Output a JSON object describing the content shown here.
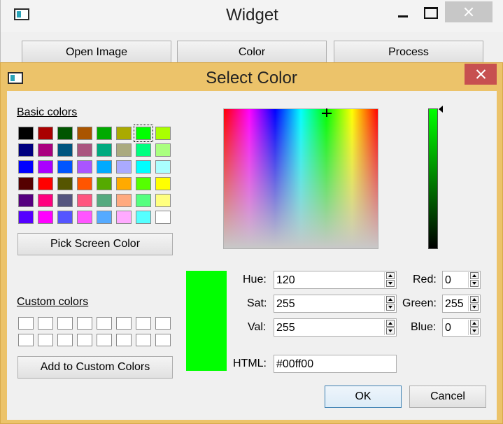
{
  "background_window": {
    "title": "Widget",
    "buttons": [
      "Open Image",
      "Color",
      "Process"
    ]
  },
  "dialog": {
    "title": "Select Color",
    "basic_colors_label": "Basic colors",
    "basic_colors": [
      [
        "#000000",
        "#aa0000",
        "#005500",
        "#aa5500",
        "#00aa00",
        "#aaaa00",
        "#00ff00",
        "#aaff00"
      ],
      [
        "#00007f",
        "#aa007f",
        "#00557f",
        "#aa557f",
        "#00aa7f",
        "#aaaa7f",
        "#00ff7f",
        "#aaff7f"
      ],
      [
        "#0000ff",
        "#aa00ff",
        "#0055ff",
        "#aa55ff",
        "#00aaff",
        "#aaaaff",
        "#00ffff",
        "#aaffff"
      ],
      [
        "#550000",
        "#ff0000",
        "#555500",
        "#ff5500",
        "#55aa00",
        "#ffaa00",
        "#55ff00",
        "#ffff00"
      ],
      [
        "#55007f",
        "#ff007f",
        "#55557f",
        "#ff557f",
        "#55aa7f",
        "#ffaa7f",
        "#55ff7f",
        "#ffff7f"
      ],
      [
        "#5500ff",
        "#ff00ff",
        "#5555ff",
        "#ff55ff",
        "#55aaff",
        "#ffaaff",
        "#55ffff",
        "#ffffff"
      ]
    ],
    "selected_basic_color": "#00ff00",
    "pick_screen_label": "Pick Screen Color",
    "custom_colors_label": "Custom colors",
    "add_custom_label": "Add to Custom Colors",
    "current_color": "#00ff00",
    "fields": {
      "hue_label": "Hue:",
      "hue": "120",
      "sat_label": "Sat:",
      "sat": "255",
      "val_label": "Val:",
      "val": "255",
      "red_label": "Red:",
      "red": "0",
      "green_label": "Green:",
      "green": "255",
      "blue_label": "Blue:",
      "blue": "0",
      "html_label": "HTML:",
      "html": "#00ff00"
    },
    "ok_label": "OK",
    "cancel_label": "Cancel"
  }
}
